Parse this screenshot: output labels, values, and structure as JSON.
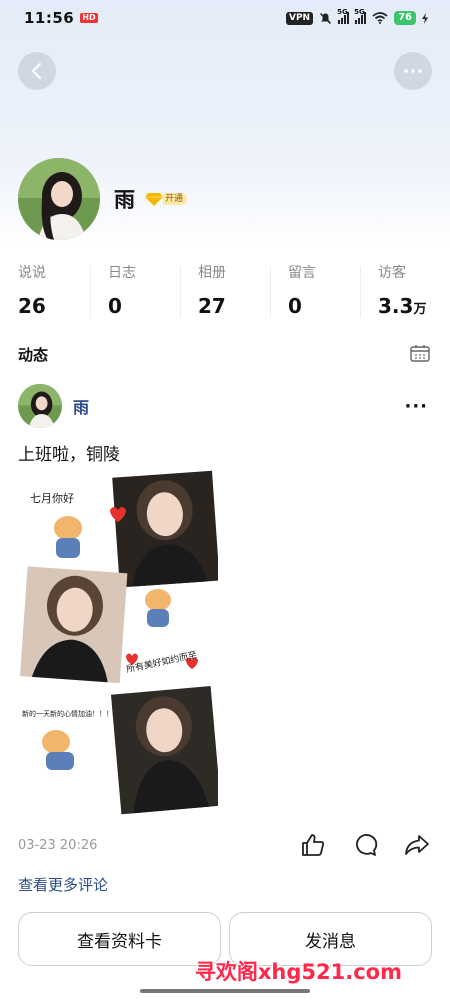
{
  "status_bar": {
    "time": "11:56",
    "hd_badge": "HD",
    "vpn": "VPN",
    "signal1": "5G",
    "signal2": "5G",
    "battery": "76"
  },
  "profile": {
    "name": "雨",
    "vip_label": "开通"
  },
  "stats": [
    {
      "label": "说说",
      "value": "26",
      "unit": ""
    },
    {
      "label": "日志",
      "value": "0",
      "unit": ""
    },
    {
      "label": "相册",
      "value": "27",
      "unit": ""
    },
    {
      "label": "留言",
      "value": "0",
      "unit": ""
    },
    {
      "label": "访客",
      "value": "3.3",
      "unit": "万"
    }
  ],
  "feed": {
    "title": "动态"
  },
  "post": {
    "author": "雨",
    "text": "上班啦，铜陵",
    "image_captions": [
      "七月你好",
      "所有美好如约而至",
      "新的一天新的心情加油！！！"
    ],
    "time": "03-23 20:26",
    "more_comments": "查看更多评论"
  },
  "buttons": {
    "view_card": "查看资料卡",
    "send_message": "发消息"
  },
  "watermark": "寻欢阁xhg521.com",
  "colors": {
    "link": "#2a4b8d",
    "watermark": "#ff2a4b",
    "battery": "#3cc46a"
  }
}
